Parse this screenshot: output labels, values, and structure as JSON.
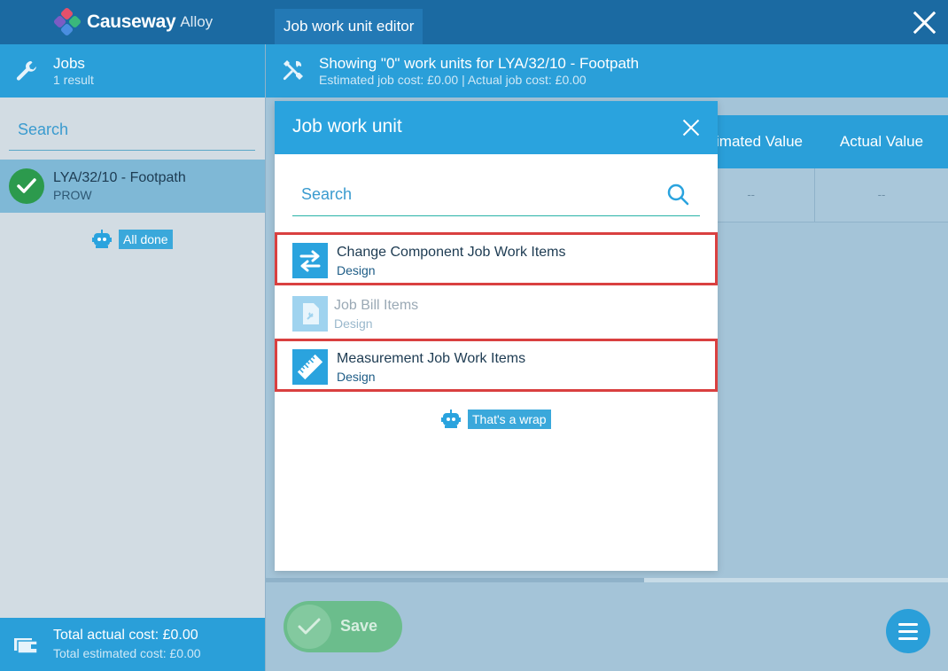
{
  "app": {
    "brand": "Causeway",
    "brand_sub": "Alloy",
    "tab_title": "Job work unit editor"
  },
  "left": {
    "header_title": "Jobs",
    "header_sub": "1 result",
    "search_placeholder": "Search",
    "job": {
      "title": "LYA/32/10 - Footpath",
      "subtitle": "PROW"
    },
    "status": "All done",
    "footer_title": "Total actual cost: £0.00",
    "footer_sub": "Total estimated cost: £0.00"
  },
  "main": {
    "header_title": "Showing \"0\" work units for LYA/32/10 - Footpath",
    "header_sub": "Estimated job cost: £0.00 | Actual job cost: £0.00",
    "columns": [
      "Estimated Value",
      "Actual Value"
    ],
    "row": [
      "--",
      "--"
    ],
    "save_label": "Save"
  },
  "dialog": {
    "title": "Job work unit",
    "search_placeholder": "Search",
    "items": [
      {
        "title": "Change Component Job Work Items",
        "subtitle": "Design",
        "icon": "swap-arrows-icon",
        "highlighted": true,
        "disabled": false
      },
      {
        "title": "Job Bill Items",
        "subtitle": "Design",
        "icon": "document-icon",
        "highlighted": false,
        "disabled": true
      },
      {
        "title": "Measurement Job Work Items",
        "subtitle": "Design",
        "icon": "ruler-icon",
        "highlighted": true,
        "disabled": false
      }
    ],
    "status": "That's a wrap"
  },
  "colors": {
    "accent": "#2aa3de",
    "header": "#1b6aa2",
    "success": "#2c9a4d",
    "highlight": "#d94040",
    "save": "#6bbd8c"
  }
}
